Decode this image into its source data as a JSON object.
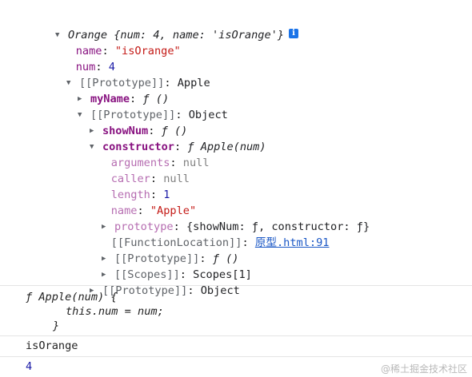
{
  "tree": {
    "root": {
      "label": "Orange",
      "preview": "{num: 4, name: 'isOrange'}",
      "info": "i"
    },
    "name_key": "name",
    "name_value": "\"isOrange\"",
    "num_key": "num",
    "num_value": "4",
    "proto1": {
      "key": "[[Prototype]]",
      "value": "Apple"
    },
    "myName": {
      "key": "myName",
      "value": "ƒ ()"
    },
    "proto2": {
      "key": "[[Prototype]]",
      "value": "Object"
    },
    "showNum": {
      "key": "showNum",
      "value": "ƒ ()"
    },
    "constructor": {
      "key": "constructor",
      "value": "ƒ Apple(num)"
    },
    "arguments": {
      "key": "arguments",
      "value": "null"
    },
    "caller": {
      "key": "caller",
      "value": "null"
    },
    "length": {
      "key": "length",
      "value": "1"
    },
    "fname": {
      "key": "name",
      "value": "\"Apple\""
    },
    "prototype": {
      "key": "prototype",
      "value": "{showNum: ƒ, constructor: ƒ}"
    },
    "functionLocation": {
      "key": "[[FunctionLocation]]",
      "link": "原型.html:91"
    },
    "proto3": {
      "key": "[[Prototype]]",
      "value": "ƒ ()"
    },
    "scopes": {
      "key": "[[Scopes]]",
      "value": "Scopes[1]"
    },
    "proto4": {
      "key": "[[Prototype]]",
      "value": "Object"
    }
  },
  "function_output": {
    "line1": "ƒ Apple(num) {",
    "line2": "this.num = num;",
    "line3": "}"
  },
  "log1": "isOrange",
  "log2": "4",
  "watermark": "@稀土掘金技术社区",
  "glyphs": {
    "expanded": "▼",
    "collapsed": "▶"
  },
  "colors": {
    "key_own": "#881280",
    "string": "#c41a16",
    "number": "#1a1aa6",
    "null": "#808080",
    "link": "#1a57c6",
    "info_badge": "#1a73e8"
  }
}
